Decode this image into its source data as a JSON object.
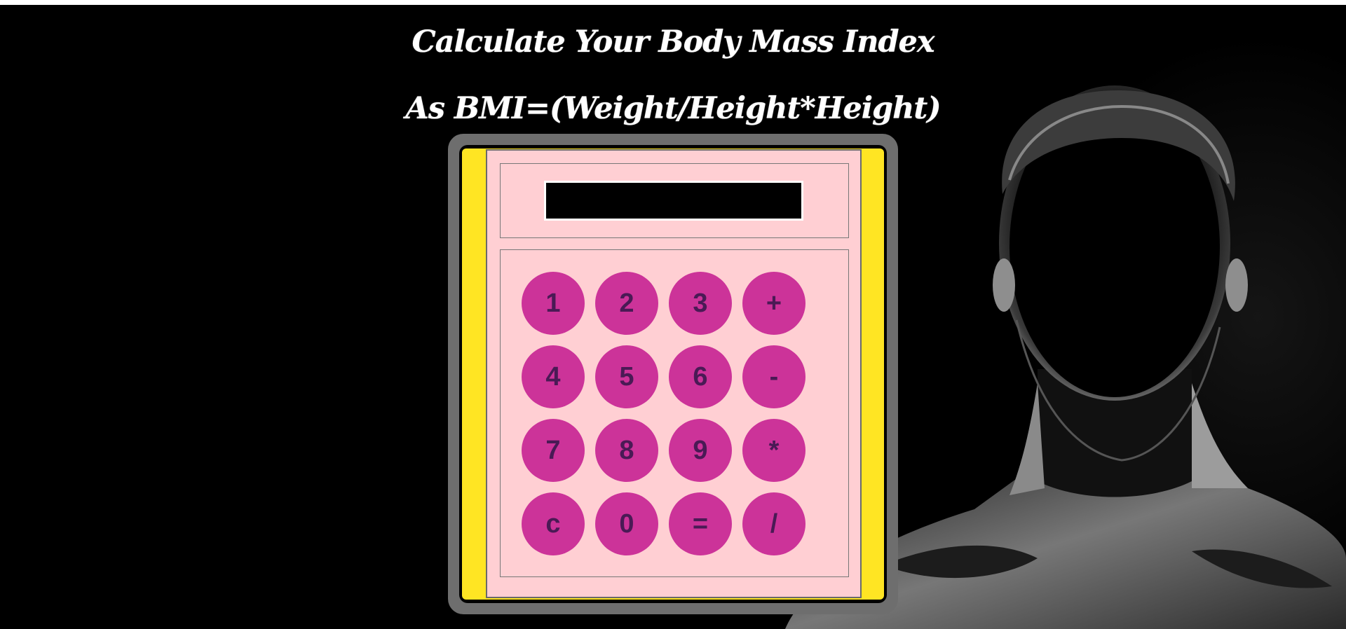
{
  "header": {
    "title": "Calculate Your Body Mass Index",
    "formula": "As BMI=(Weight/Height*Height)"
  },
  "calculator": {
    "display_value": "",
    "keys": [
      "1",
      "2",
      "3",
      "+",
      "4",
      "5",
      "6",
      "-",
      "7",
      "8",
      "9",
      "*",
      "c",
      "0",
      "=",
      "/"
    ]
  },
  "colors": {
    "background": "#000000",
    "frame": "#6e6e6e",
    "side_panel": "#ffe523",
    "face": "#ffcfd3",
    "key": "#cc3399",
    "key_text": "#4a1a55"
  }
}
